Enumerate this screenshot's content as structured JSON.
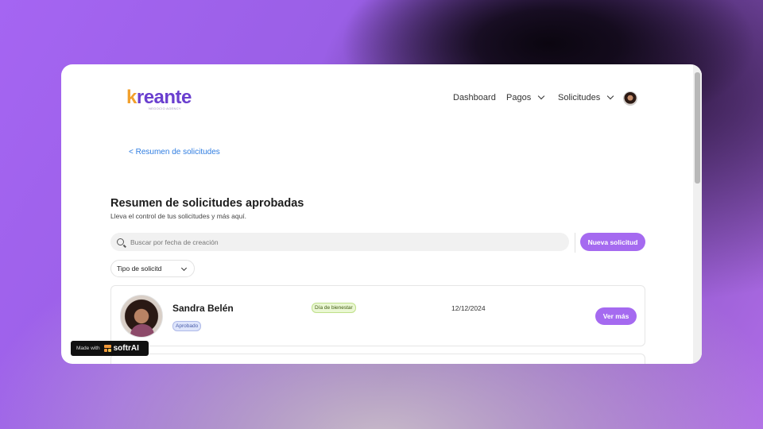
{
  "header": {
    "logo_text_k": "k",
    "logo_text_rest": "reante",
    "logo_tagline": "NEGOCIO  AGENCY",
    "nav": [
      {
        "label": "Dashboard",
        "has_dropdown": false
      },
      {
        "label": "Pagos",
        "has_dropdown": true
      },
      {
        "label": "Solicitudes",
        "has_dropdown": true
      }
    ]
  },
  "back_link": "< Resumen de solicitudes",
  "page": {
    "title": "Resumen de solicitudes aprobadas",
    "subtitle": "Lleva el control de tus solicitudes y más aquí."
  },
  "search": {
    "placeholder": "Buscar por fecha de creación"
  },
  "new_request_button": "Nueva solicitud",
  "filter": {
    "selected": "Tipo de solicitd"
  },
  "requests": [
    {
      "name": "Sandra Belén",
      "status": "Aprobado",
      "type": "Día de bienestar",
      "date": "12/12/2024",
      "action": "Ver más"
    }
  ],
  "badge": {
    "made_with": "Made with",
    "brand": "softrAI"
  },
  "colors": {
    "accent": "#a56af0",
    "link": "#2f7de1",
    "logo": "#6a3fcf",
    "status_badge_bg": "#dde4fb",
    "type_badge_bg": "#eaf7d3"
  }
}
